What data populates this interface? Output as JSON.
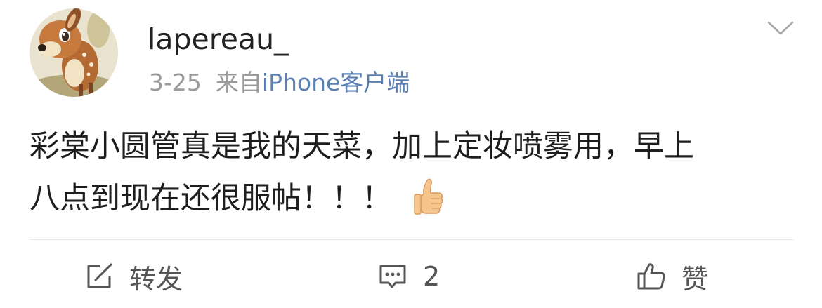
{
  "post": {
    "user": {
      "name": "lapereau_",
      "avatar_icon": "bambi-avatar"
    },
    "meta": {
      "date": "3-25",
      "via": "来自",
      "client": "iPhone客户端"
    },
    "content": {
      "line1": "彩棠小圆管真是我的天菜，加上定妆喷雾用，早上",
      "line2": "八点到现在还很服帖！！！",
      "emoji": "thumbs-up-emoji"
    },
    "actions": {
      "repost_label": "转发",
      "comment_count": "2",
      "like_label": "赞"
    },
    "menu_icon": "chevron-down-icon"
  },
  "colors": {
    "text": "#1e1e1e",
    "muted": "#9b9b9b",
    "link": "#5a7fb2",
    "icon": "#555555",
    "divider": "#e6e6e6"
  }
}
